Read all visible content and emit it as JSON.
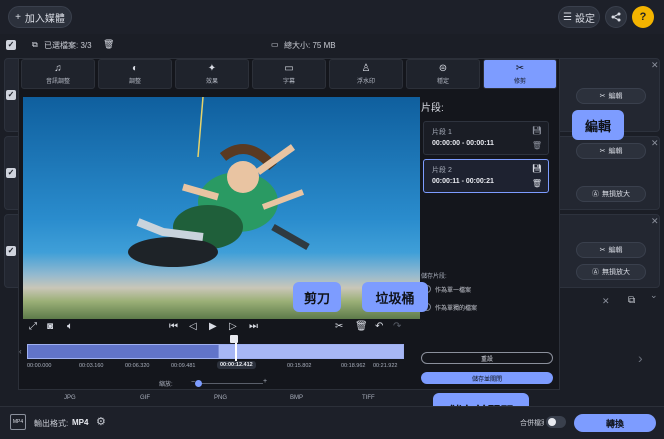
{
  "topbar": {
    "add_label": "加入媒體",
    "settings_label": "設定",
    "help_label": "?"
  },
  "info": {
    "selected_files": "已選檔案: 3/3",
    "total_size": "總大小: 75 MB"
  },
  "tabs": [
    {
      "label": "音訊調整",
      "icon": "audio-icon"
    },
    {
      "label": "調整",
      "icon": "adjust-icon"
    },
    {
      "label": "效果",
      "icon": "effects-icon"
    },
    {
      "label": "字幕",
      "icon": "subtitles-icon"
    },
    {
      "label": "浮水印",
      "icon": "watermark-icon"
    },
    {
      "label": "穩定",
      "icon": "stabilize-icon"
    },
    {
      "label": "修剪",
      "icon": "trim-icon"
    }
  ],
  "segments": {
    "title": "片段:",
    "items": [
      {
        "name": "片段 1",
        "range": "00:00:00 - 00:00:11"
      },
      {
        "name": "片段 2",
        "range": "00:00:11 - 00:00:21"
      }
    ]
  },
  "save_options": {
    "label": "儲存片段:",
    "opt1": "作為單一檔案",
    "opt2": "作為單獨的檔案"
  },
  "buttons": {
    "reset": "重設",
    "save_close": "儲存並關閉",
    "convert": "轉換",
    "edit": "編輯",
    "upscale": "無損放大"
  },
  "timeline": {
    "ticks": [
      "00:00.000",
      "00:03.160",
      "00:06.320",
      "00:09.481",
      "00:12.412",
      "00:15.802",
      "00:18.962",
      "00:21.922"
    ],
    "current": "00:00:12.412",
    "zoom_label": "縮放:"
  },
  "callouts": {
    "edit": "編輯",
    "scissors": "剪刀",
    "trash": "垃圾桶",
    "save_close": "儲存並關閉"
  },
  "format_strip": [
    "JPG",
    "GIF",
    "PNG",
    "BMP",
    "TIFF"
  ],
  "bottom": {
    "output_label": "輸出格式:",
    "output_value": "MP4",
    "merge_label": "合併檔案:"
  },
  "colors": {
    "accent": "#7d9cff",
    "help": "#f4b400",
    "background": "#1b1e26"
  }
}
